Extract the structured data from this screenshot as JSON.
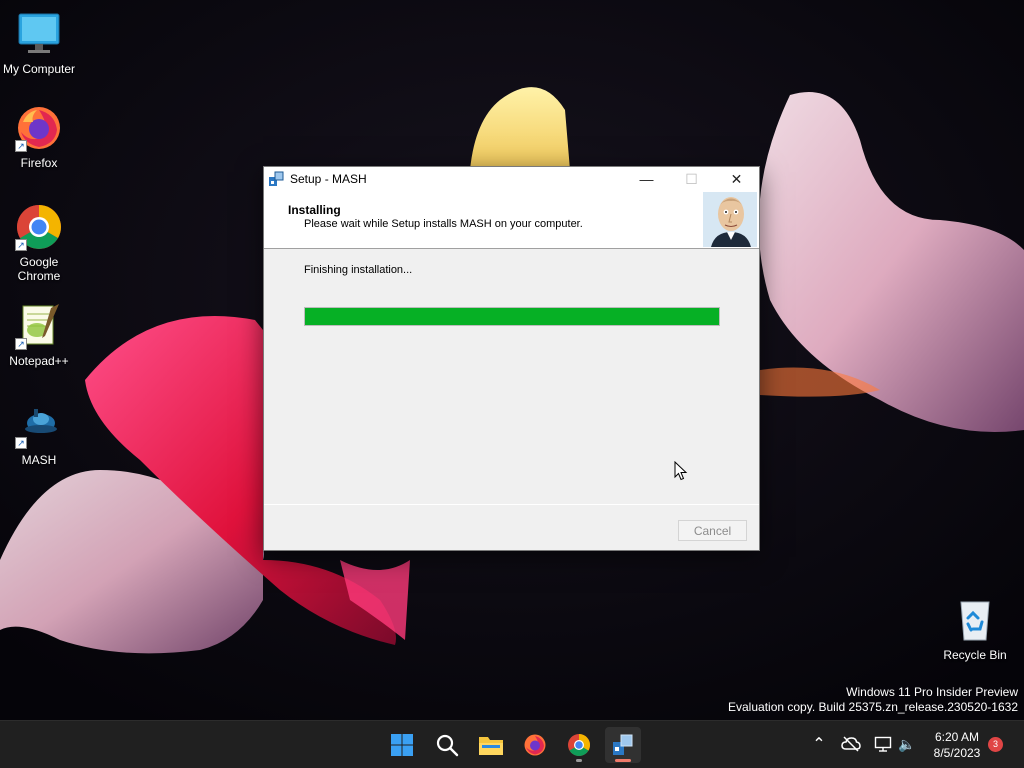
{
  "desktop": {
    "icons": [
      {
        "label": "My Computer"
      },
      {
        "label": "Firefox"
      },
      {
        "label": "Google Chrome"
      },
      {
        "label": "Notepad++"
      },
      {
        "label": "MASH"
      },
      {
        "label": "Recycle Bin"
      }
    ],
    "watermark": {
      "line1": "Windows 11 Pro Insider Preview",
      "line2": "Evaluation copy. Build 25375.zn_release.230520-1632"
    }
  },
  "setup_window": {
    "title": "Setup - MASH",
    "minimize_glyph": "—",
    "maximize_glyph": "☐",
    "close_glyph": "✕",
    "heading": "Installing",
    "subheading": "Please wait while Setup installs MASH on your computer.",
    "status": "Finishing installation...",
    "progress_percent": 100,
    "progress_color": "#06b025",
    "cancel_label": "Cancel"
  },
  "taskbar": {
    "pinned": [
      "windows-start-icon",
      "search-icon",
      "file-explorer-icon",
      "firefox-icon",
      "chrome-icon",
      "mash-setup-icon"
    ],
    "tray": [
      "chevron-up-icon",
      "cloud-offline-icon",
      "network-icon",
      "volume-icon"
    ],
    "chevron_glyph": "⌃",
    "volume_glyph": "🔈",
    "clock_time": "6:20 AM",
    "clock_date": "8/5/2023",
    "notification_count": "3"
  }
}
